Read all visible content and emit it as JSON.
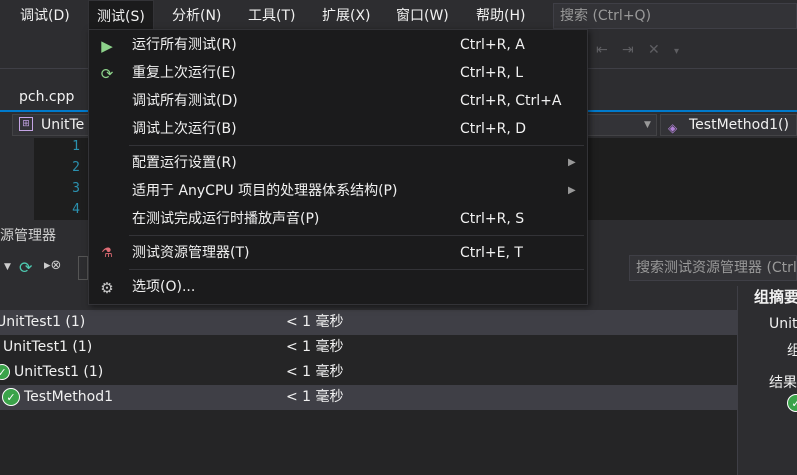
{
  "menubar": {
    "items": [
      {
        "label": "调试(D)"
      },
      {
        "label": "测试(S)"
      },
      {
        "label": "分析(N)"
      },
      {
        "label": "工具(T)"
      },
      {
        "label": "扩展(X)"
      },
      {
        "label": "窗口(W)"
      },
      {
        "label": "帮助(H)"
      }
    ],
    "search_placeholder": "搜索 (Ctrl+Q)"
  },
  "editor": {
    "tab_label": "pch.cpp",
    "nav_left": "UnitTe",
    "nav_right": "TestMethod1()",
    "line_numbers": [
      "1",
      "2",
      "3",
      "4"
    ]
  },
  "test_menu": {
    "items": [
      {
        "label": "运行所有测试(R)",
        "shortcut": "Ctrl+R, A",
        "icon": "run-all-icon"
      },
      {
        "label": "重复上次运行(E)",
        "shortcut": "Ctrl+R, L",
        "icon": "repeat-icon"
      },
      {
        "label": "调试所有测试(D)",
        "shortcut": "Ctrl+R, Ctrl+A"
      },
      {
        "label": "调试上次运行(B)",
        "shortcut": "Ctrl+R, D"
      },
      {
        "label": "配置运行设置(R)",
        "submenu": true
      },
      {
        "label": "适用于 AnyCPU 项目的处理器体系结构(P)",
        "submenu": true
      },
      {
        "label": "在测试完成运行时播放声音(P)",
        "shortcut": "Ctrl+R, S"
      },
      {
        "label": "测试资源管理器(T)",
        "shortcut": "Ctrl+E, T",
        "icon": "test-explorer-icon"
      },
      {
        "label": "选项(O)...",
        "icon": "gear-icon"
      }
    ]
  },
  "test_explorer": {
    "title": "源管理器",
    "search_placeholder": "搜索测试资源管理器 (Ctrl",
    "rows": [
      {
        "name": "UnitTest1 (1)",
        "duration": "< 1 毫秒"
      },
      {
        "name": "UnitTest1 (1)",
        "duration": "< 1 毫秒"
      },
      {
        "name": "UnitTest1 (1)",
        "duration": "< 1 毫秒"
      },
      {
        "name": "TestMethod1",
        "duration": "< 1 毫秒"
      }
    ],
    "summary": {
      "title": "组摘要",
      "line1": "Unit",
      "line2": "组",
      "line3": "结果"
    }
  },
  "colors": {
    "accent": "#007acc",
    "pass": "#3ba34a",
    "menu_bg": "#1b1b1c"
  }
}
